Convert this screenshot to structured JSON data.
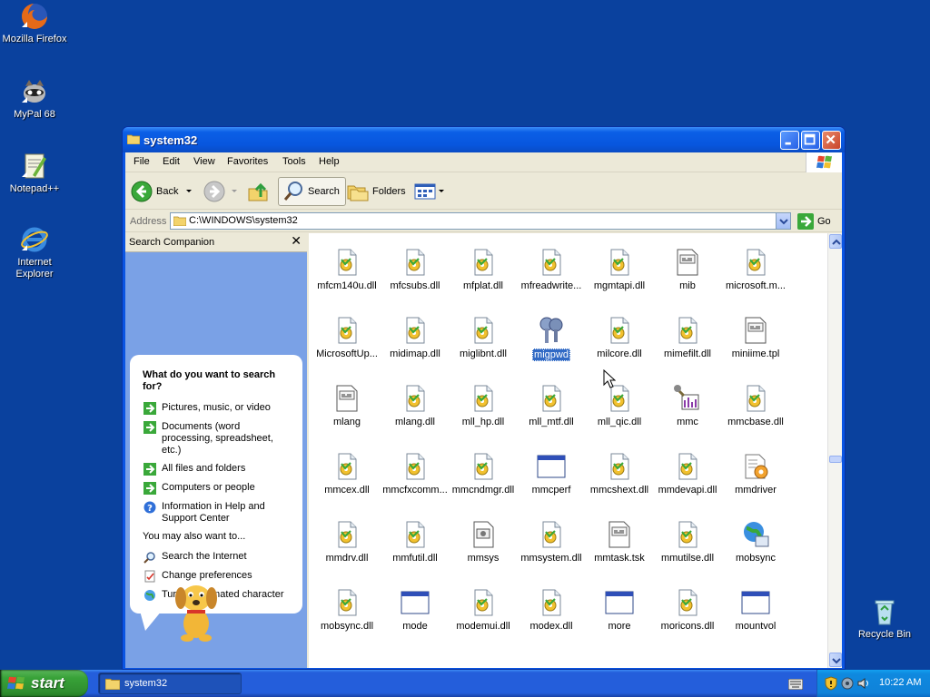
{
  "desktop": {
    "icons": [
      {
        "label": "Mozilla Firefox",
        "icon": "firefox-icon"
      },
      {
        "label": "MyPal 68",
        "icon": "mypal-icon"
      },
      {
        "label": "Notepad++",
        "icon": "notepadpp-icon"
      },
      {
        "label": "Internet Explorer",
        "icon": "ie-icon"
      }
    ],
    "recycle_bin": "Recycle Bin"
  },
  "window": {
    "title": "system32",
    "menu": [
      "File",
      "Edit",
      "View",
      "Favorites",
      "Tools",
      "Help"
    ],
    "toolbar": {
      "back": "Back",
      "search": "Search",
      "folders": "Folders"
    },
    "address": {
      "label": "Address",
      "value": "C:\\WINDOWS\\system32",
      "go": "Go"
    }
  },
  "search_pane": {
    "title": "Search Companion",
    "question": "What do you want to search for?",
    "options": [
      "Pictures, music, or video",
      "Documents (word processing, spreadsheet, etc.)",
      "All files and folders",
      "Computers or people",
      "Information in Help and Support Center"
    ],
    "also_label": "You may also want to...",
    "also": [
      "Search the Internet",
      "Change preferences",
      "Turn off animated character"
    ]
  },
  "files": [
    {
      "name": "mfcm140u.dll",
      "type": "dll"
    },
    {
      "name": "mfcsubs.dll",
      "type": "dll"
    },
    {
      "name": "mfplat.dll",
      "type": "dll"
    },
    {
      "name": "mfreadwrite...",
      "type": "dll"
    },
    {
      "name": "mgmtapi.dll",
      "type": "dll"
    },
    {
      "name": "mib",
      "type": "doc"
    },
    {
      "name": "microsoft.m...",
      "type": "dll"
    },
    {
      "name": "MicrosoftUp...",
      "type": "dll"
    },
    {
      "name": "midimap.dll",
      "type": "dll"
    },
    {
      "name": "miglibnt.dll",
      "type": "dll"
    },
    {
      "name": "migpwd",
      "type": "keys",
      "selected": true
    },
    {
      "name": "milcore.dll",
      "type": "dll"
    },
    {
      "name": "mimefilt.dll",
      "type": "dll"
    },
    {
      "name": "miniime.tpl",
      "type": "doc"
    },
    {
      "name": "mlang",
      "type": "doc"
    },
    {
      "name": "mlang.dll",
      "type": "dll"
    },
    {
      "name": "mll_hp.dll",
      "type": "dll"
    },
    {
      "name": "mll_mtf.dll",
      "type": "dll"
    },
    {
      "name": "mll_qic.dll",
      "type": "dll"
    },
    {
      "name": "mmc",
      "type": "tool"
    },
    {
      "name": "mmcbase.dll",
      "type": "dll"
    },
    {
      "name": "mmcex.dll",
      "type": "dll"
    },
    {
      "name": "mmcfxcomm...",
      "type": "dll"
    },
    {
      "name": "mmcndmgr.dll",
      "type": "dll"
    },
    {
      "name": "mmcperf",
      "type": "exe"
    },
    {
      "name": "mmcshext.dll",
      "type": "dll"
    },
    {
      "name": "mmdevapi.dll",
      "type": "dll"
    },
    {
      "name": "mmdriver",
      "type": "gear"
    },
    {
      "name": "mmdrv.dll",
      "type": "dll"
    },
    {
      "name": "mmfutil.dll",
      "type": "dll"
    },
    {
      "name": "mmsys",
      "type": "cpl"
    },
    {
      "name": "mmsystem.dll",
      "type": "dll"
    },
    {
      "name": "mmtask.tsk",
      "type": "doc"
    },
    {
      "name": "mmutilse.dll",
      "type": "dll"
    },
    {
      "name": "mobsync",
      "type": "globe"
    },
    {
      "name": "mobsync.dll",
      "type": "dll"
    },
    {
      "name": "mode",
      "type": "exe"
    },
    {
      "name": "modemui.dll",
      "type": "dll"
    },
    {
      "name": "modex.dll",
      "type": "dll"
    },
    {
      "name": "more",
      "type": "exe"
    },
    {
      "name": "moricons.dll",
      "type": "dll"
    },
    {
      "name": "mountvol",
      "type": "exe"
    }
  ],
  "taskbar": {
    "start": "start",
    "task": "system32",
    "clock": "10:22 AM"
  }
}
